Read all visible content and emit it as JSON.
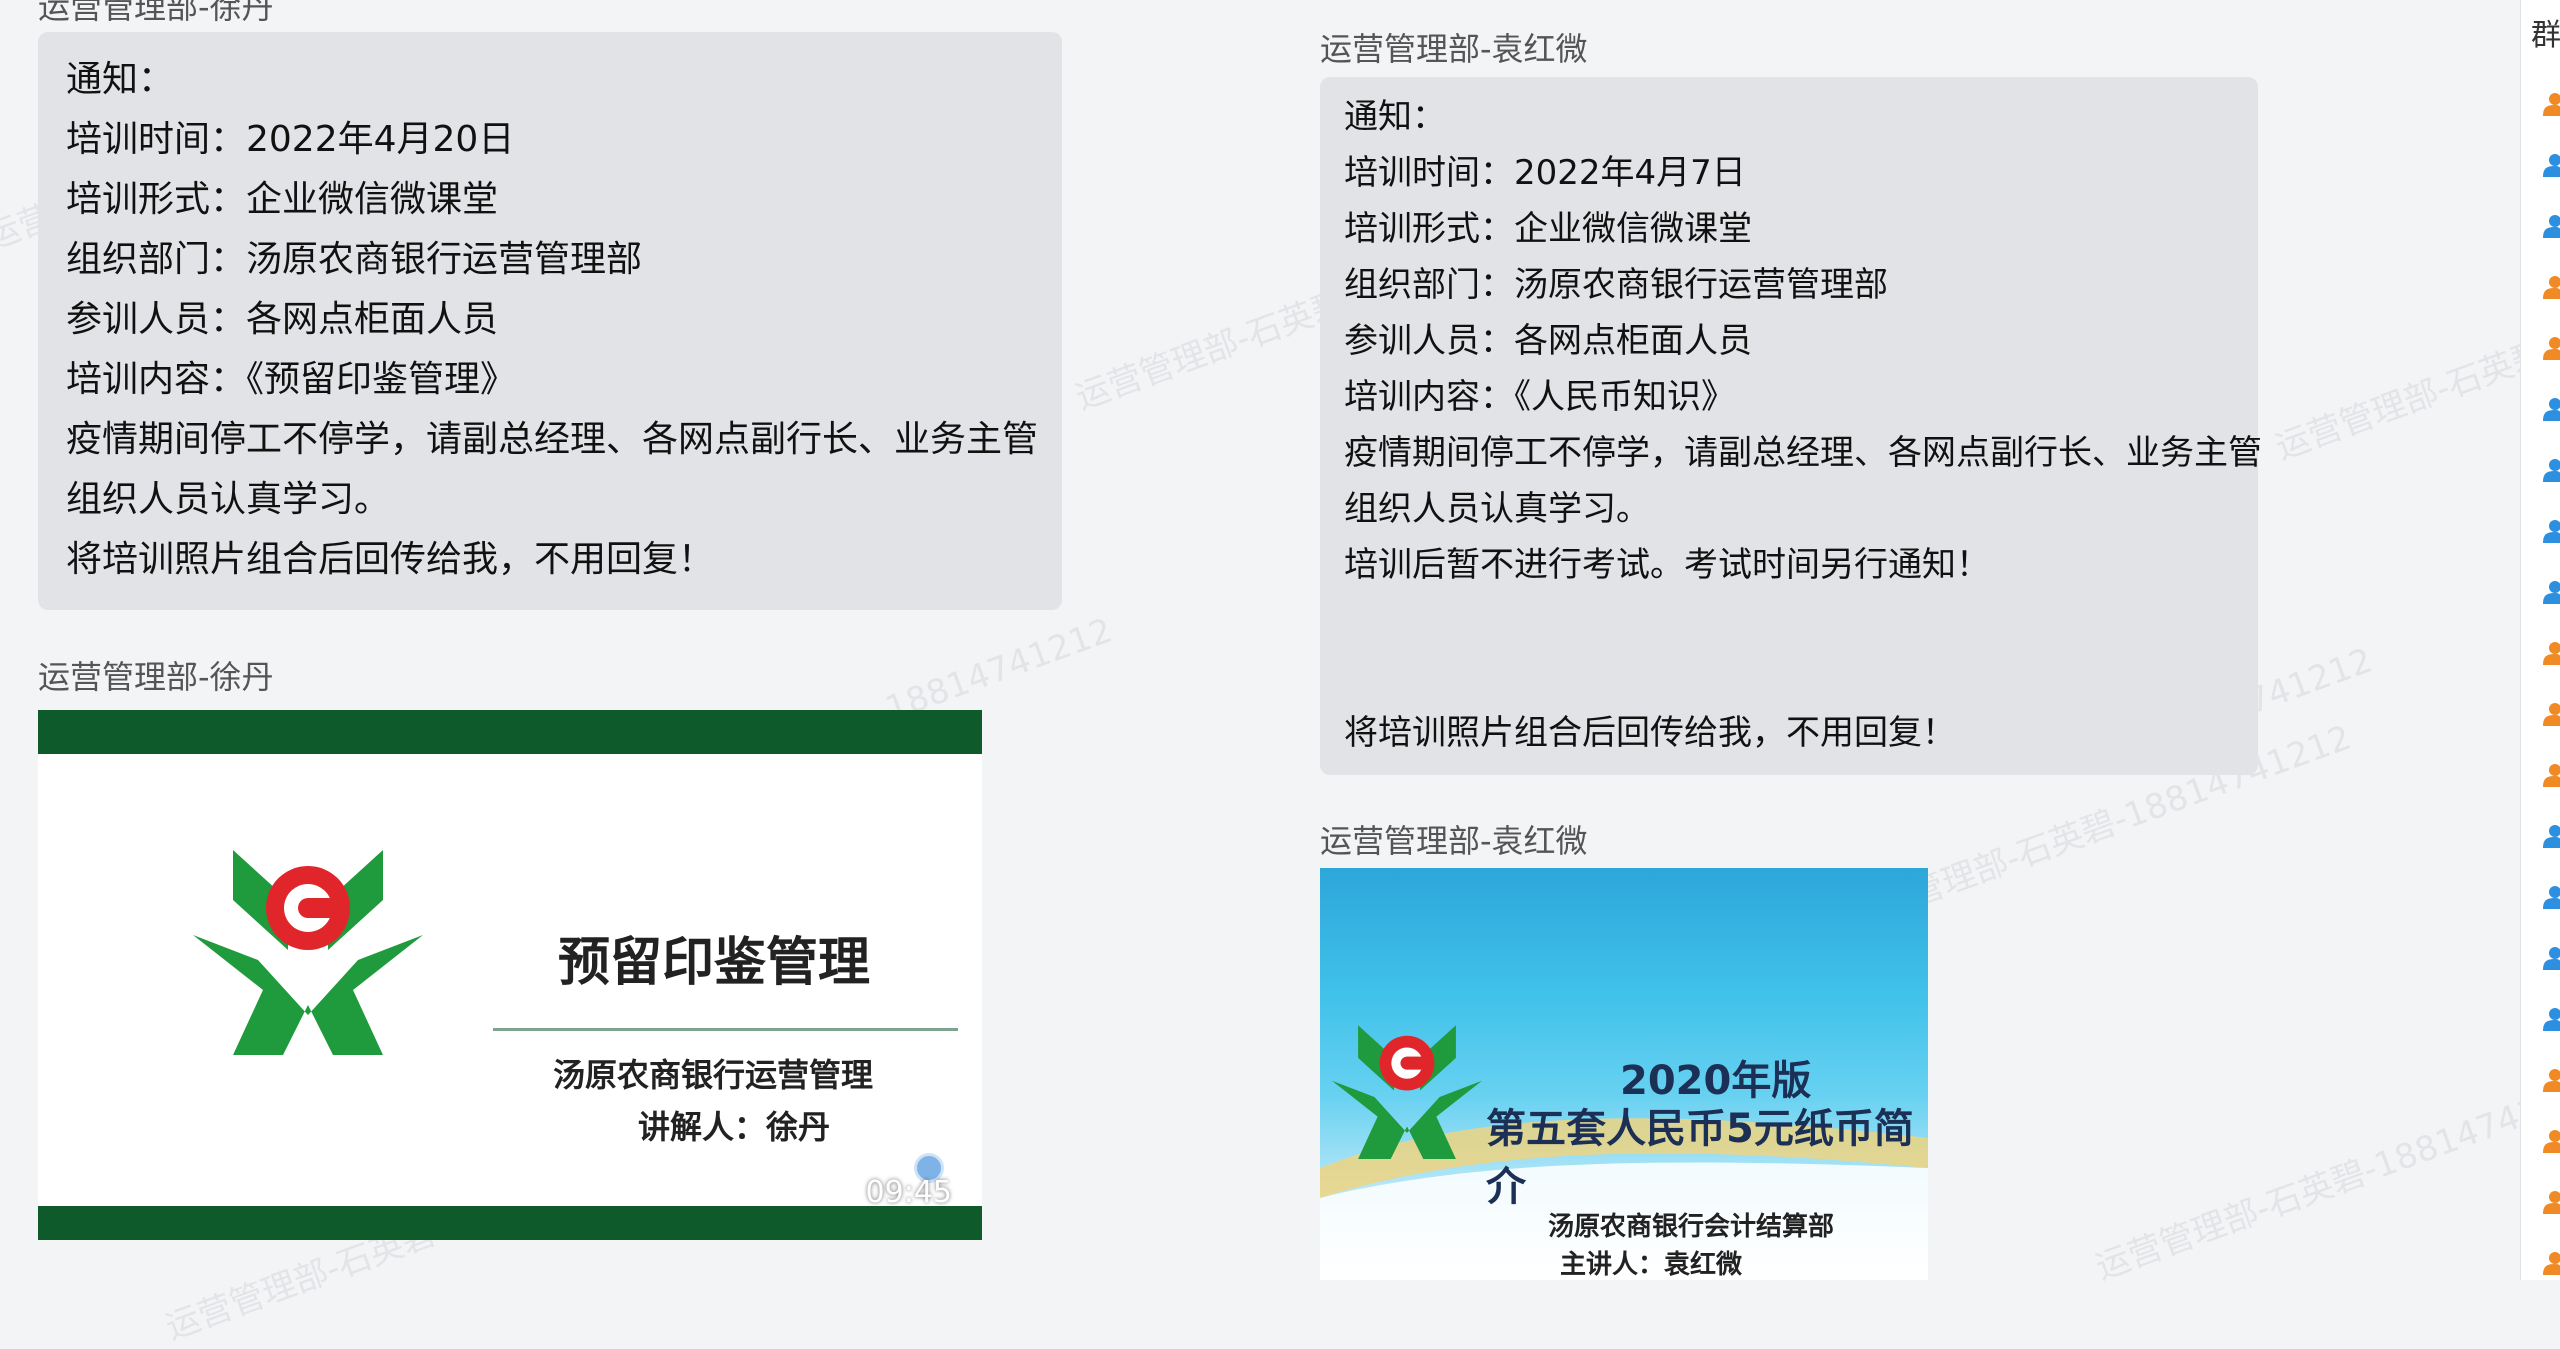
{
  "watermark": {
    "texts": [
      "运营管理部-石英碧-18814741212",
      "运营管理部-石英碧-18814741212",
      "18814741212",
      "运营管理部-石英碧-18814741212",
      "18814741212",
      "运营管理部-石英碧-18814741212",
      "运营管理部-石英碧-18814741212",
      "运营管理部-石英碧-18814741212"
    ]
  },
  "left_column": {
    "top_sender": "运营管理部-徐丹",
    "message": {
      "lines": [
        "通知：",
        "培训时间：2022年4月20日",
        "培训形式：企业微信微课堂",
        "组织部门：汤原农商银行运营管理部",
        "参训人员：各网点柜面人员",
        "培训内容：《预留印鉴管理》",
        "疫情期间停工不停学，请副总经理、各网点副行长、业务主管",
        "组织人员认真学习。",
        "将培训照片组合后回传给我，不用回复！"
      ]
    },
    "video_sender": "运营管理部-徐丹",
    "video": {
      "title": "预留印鉴管理",
      "organization": "汤原农商银行运营管理",
      "presenter": "讲解人：徐丹",
      "duration": "09:45",
      "icon": "video-camera-icon"
    }
  },
  "right_column": {
    "message_sender": "运营管理部-袁红微",
    "message": {
      "lines": [
        "通知：",
        "培训时间：2022年4月7日",
        "培训形式：企业微信微课堂",
        "组织部门：汤原农商银行运营管理部",
        "参训人员：各网点柜面人员",
        "培训内容：《人民币知识》",
        "疫情期间停工不停学，请副总经理、各网点副行长、业务主管",
        "组织人员认真学习。",
        "培训后暂不进行考试。考试时间另行通知！",
        "",
        "",
        "将培训照片组合后回传给我，不用回复！"
      ]
    },
    "image_sender": "运营管理部-袁红微",
    "image": {
      "title_line1": "2020年版",
      "title_line2": "第五套人民币5元纸币简介",
      "organization": "汤原农商银行会计结算部",
      "presenter": "主讲人：袁红微"
    }
  },
  "sidebar": {
    "header": "群",
    "member_icons": [
      "person-orange",
      "person-blue",
      "person-blue",
      "person-orange",
      "person-orange",
      "person-blue",
      "person-blue",
      "person-blue",
      "person-blue",
      "person-orange",
      "person-orange",
      "person-orange",
      "person-blue",
      "person-blue",
      "person-blue",
      "person-blue",
      "person-orange",
      "person-orange",
      "person-orange",
      "person-orange"
    ]
  },
  "colors": {
    "bubble": "#e2e3e6",
    "background": "#f3f4f6",
    "bank_green": "#0f5a2a",
    "logo_green": "#1f9a3c",
    "logo_red": "#e0262b",
    "person_orange": "#f08a24",
    "person_blue": "#2d8fe0"
  }
}
